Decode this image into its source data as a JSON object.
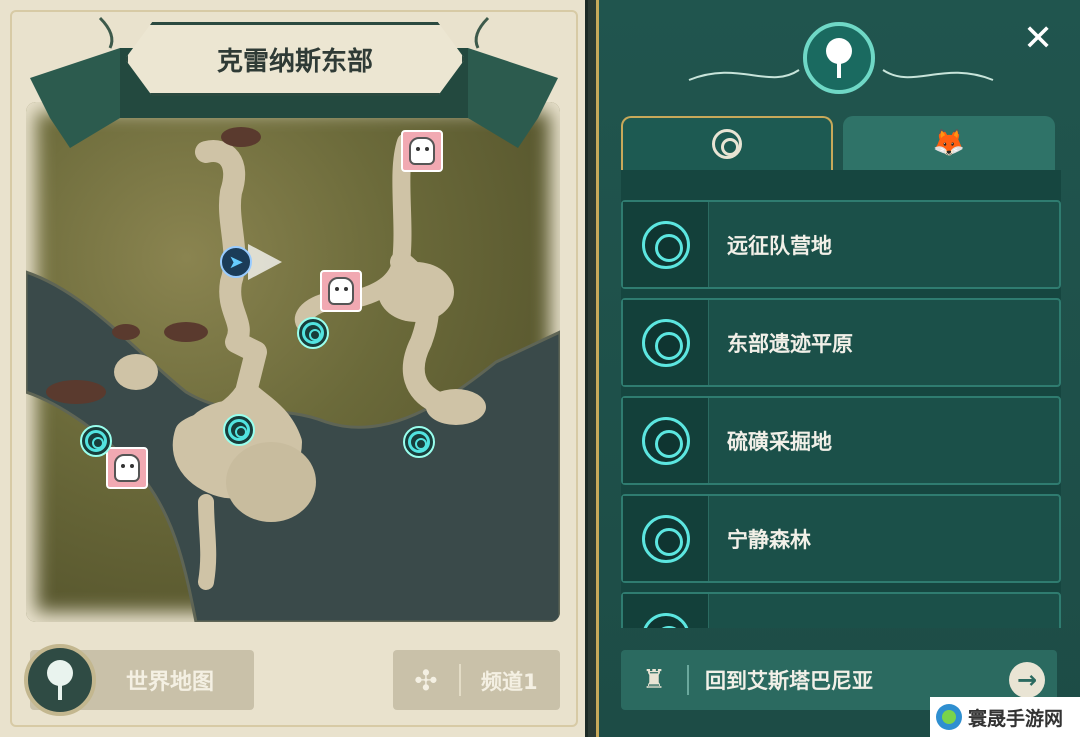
{
  "map_panel": {
    "region_title": "克雷纳斯东部",
    "world_map_button": "世界地图",
    "channel_button": "频道1",
    "icons": {
      "teleport": "spiral-teleport-icon",
      "boss": "pink-monster-icon",
      "player": "player-arrow-icon"
    }
  },
  "teleport_panel": {
    "header_icon": "map-pin-icon",
    "close_icon": "close-icon",
    "tabs": [
      {
        "icon": "spiral-icon",
        "active": true
      },
      {
        "icon": "fox-icon",
        "active": false
      }
    ],
    "locations": [
      {
        "name": "远征队营地"
      },
      {
        "name": "东部遗迹平原"
      },
      {
        "name": "硫磺采掘地"
      },
      {
        "name": "宁静森林"
      }
    ],
    "return_button": "回到艾斯塔巴尼亚"
  },
  "watermark": {
    "text": "寰晟手游网"
  },
  "colors": {
    "panel_bg": "#1d4c46",
    "accent_cyan": "#5ce6e0",
    "gold_border": "#c8a95a",
    "parchment": "#e9e2cd"
  }
}
